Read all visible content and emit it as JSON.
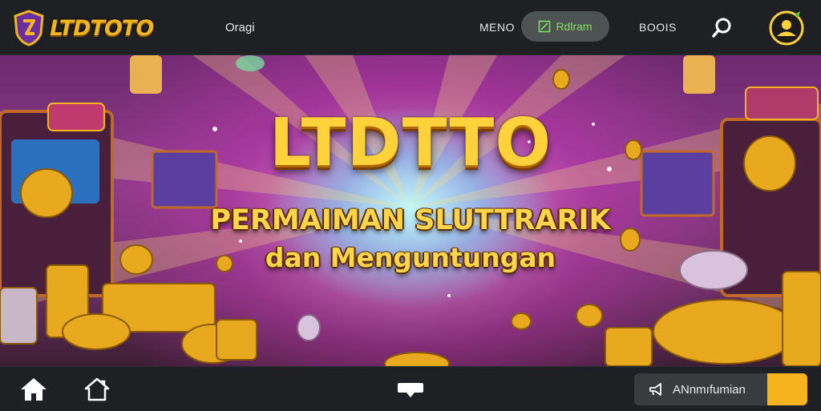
{
  "header": {
    "logo_text": "LTDTOTO",
    "nav": {
      "oragi": "Oragi",
      "menu": "MENO",
      "pill": "Rdlram",
      "boots": "BOOIS"
    }
  },
  "hero": {
    "title": "LTDTTO",
    "subtitle_line1": "PERMAIMAN SLUTTRARIK",
    "subtitle_line2": "dan Menguntungan"
  },
  "bottom_bar": {
    "announcement_label": "ANnmıfumian"
  },
  "colors": {
    "bar_bg": "#1f2023",
    "gold": "#ffd23c",
    "pill_bg": "#4d5252",
    "pill_text": "#7ee05b",
    "accent": "#f6b31d"
  },
  "icons": [
    "shield-logo-icon",
    "edit-icon",
    "search-icon",
    "avatar-icon",
    "home-icon",
    "house-icon",
    "chat-icon",
    "announcement-icon"
  ]
}
